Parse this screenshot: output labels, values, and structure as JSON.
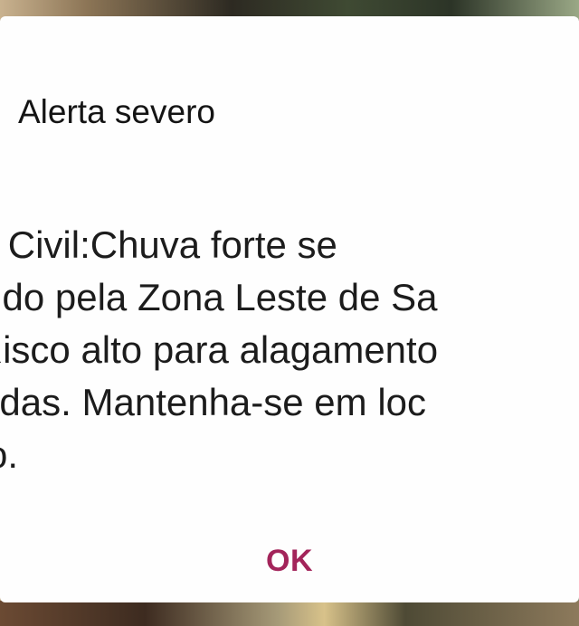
{
  "dialog": {
    "title": "Alerta severo",
    "message_lines": [
      "Defesa Civil:Chuva forte se",
      "espalhando pela Zona Leste de Sa",
      "Paulo. Risco alto para alagamento",
      "e enxurradas. Mantenha-se em loc",
      "seguro."
    ],
    "ok_label": "OK"
  },
  "colors": {
    "dialog_background": "#fefefe",
    "title_text": "#141414",
    "body_text": "#1c1c1c",
    "accent_button": "#a3245a"
  }
}
